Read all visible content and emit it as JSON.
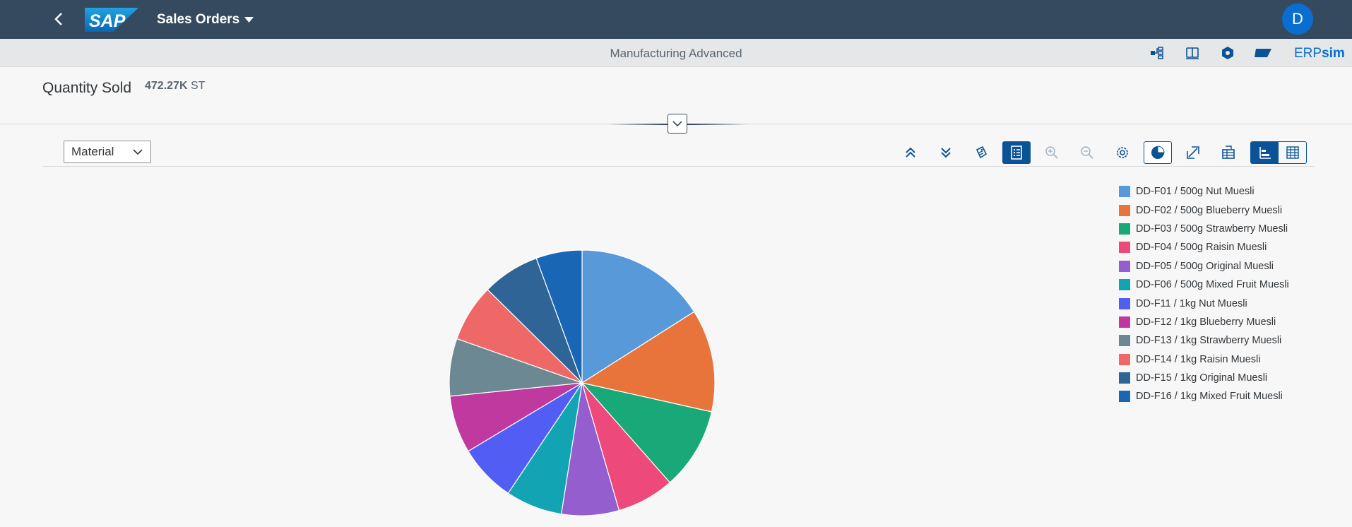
{
  "shell": {
    "title": "Sales Orders",
    "logo_text": "SAP",
    "avatar_initial": "D"
  },
  "subbar": {
    "subtitle": "Manufacturing Advanced",
    "brand_prefix": "ERP",
    "brand_suffix": "sim",
    "icons": [
      "hierarchy-icon",
      "book-icon",
      "hexagon-cube-icon",
      "flag-icon"
    ]
  },
  "kpi": {
    "title": "Quantity Sold",
    "value": "472.27K",
    "unit": "ST"
  },
  "filter": {
    "selected": "Material"
  },
  "toolbar": {
    "icons": [
      "expand-up-icon",
      "drill-down-icon",
      "tag-icon",
      "details-icon",
      "zoom-in-icon",
      "zoom-out-icon",
      "settings-icon",
      "pie-chart-icon",
      "fullscreen-icon",
      "table-export-icon",
      "bar-chart-icon",
      "grid-table-icon"
    ]
  },
  "chart_data": {
    "type": "pie",
    "categories": [
      "DD-F01 / 500g Nut Muesli",
      "DD-F02 / 500g Blueberry Muesli",
      "DD-F03 / 500g Strawberry Muesli",
      "DD-F04 / 500g Raisin Muesli",
      "DD-F05 / 500g Original Muesli",
      "DD-F06 / 500g Mixed Fruit Muesli",
      "DD-F11 / 1kg Nut Muesli",
      "DD-F12 / 1kg Blueberry Muesli",
      "DD-F13 / 1kg Strawberry Muesli",
      "DD-F14 / 1kg Raisin Muesli",
      "DD-F15 / 1kg Original Muesli",
      "DD-F16 / 1kg Mixed Fruit Muesli"
    ],
    "values": [
      16.0,
      12.5,
      10.0,
      7.0,
      7.0,
      6.9,
      7.0,
      7.0,
      7.0,
      7.0,
      7.0,
      5.6
    ],
    "colors": [
      "#5899da",
      "#e8743b",
      "#19a979",
      "#ed4a7b",
      "#945ecf",
      "#13a4b4",
      "#525df4",
      "#bf399e",
      "#6c8893",
      "#ee6868",
      "#2f6497",
      "#1866b4"
    ],
    "legend_position": "right"
  }
}
